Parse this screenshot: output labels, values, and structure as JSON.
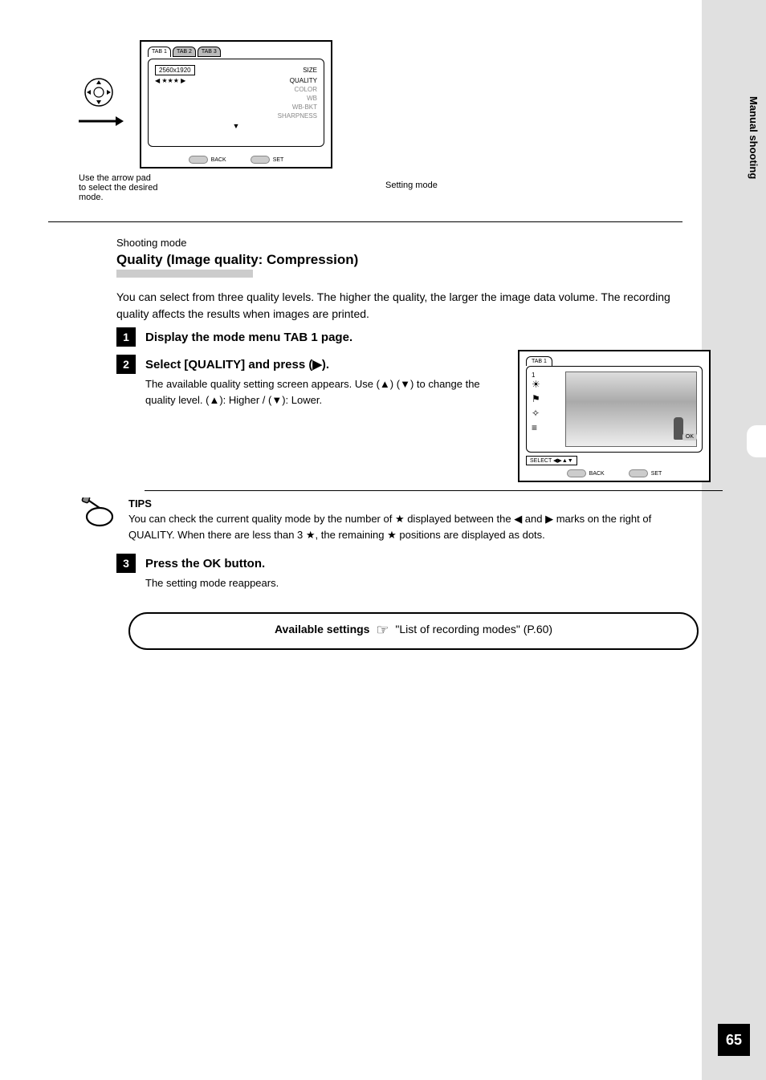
{
  "sidebar": {
    "vertical_label": "Manual shooting",
    "tab_indicator": "3"
  },
  "top_screen": {
    "tab1": "TAB 1",
    "tab2": "TAB 2",
    "tab3": "TAB 3",
    "row_size_label": "2560x1920",
    "row_size": "SIZE",
    "row_quality_val": "★★★",
    "row_quality": "QUALITY",
    "row_color": "COLOR",
    "row_wb": "WB",
    "row_wbbkt": "WB-BKT",
    "row_sharp": "SHARPNESS",
    "back": "BACK",
    "set": "SET",
    "arrow_note": "Use the arrow pad to select the desired mode.",
    "caption": "Setting mode"
  },
  "section": {
    "sub": "Shooting mode",
    "title": "Quality (Image quality: Compression)",
    "para": "You can select from three quality levels. The higher the quality, the larger the image data volume. The recording quality affects the results when images are printed."
  },
  "steps": {
    "s1": "Display the mode menu TAB 1 page.",
    "s2": "Select [QUALITY] and press (▶).",
    "s2_sub": "The available quality setting screen appears. Use (▲) (▼) to change the quality level. (▲): Higher / (▼): Lower.",
    "s3": "Press the OK button.",
    "s3_sub": "The setting mode reappears."
  },
  "small_screen": {
    "tab": "TAB 1",
    "left_label": "1",
    "ok": "OK",
    "select": "SELECT ◀▶▲▼",
    "back": "BACK",
    "set": "SET"
  },
  "tips": {
    "label": "TIPS",
    "text": "You can check the current quality mode by the number of ★ displayed between the ◀ and ▶ marks on the right of QUALITY. When there are less than 3 ★, the remaining ★ positions are displayed as dots."
  },
  "rounded_box": {
    "prefix": "Available settings",
    "link": "\"List of recording modes\" (P.60)"
  },
  "page_number": "65"
}
